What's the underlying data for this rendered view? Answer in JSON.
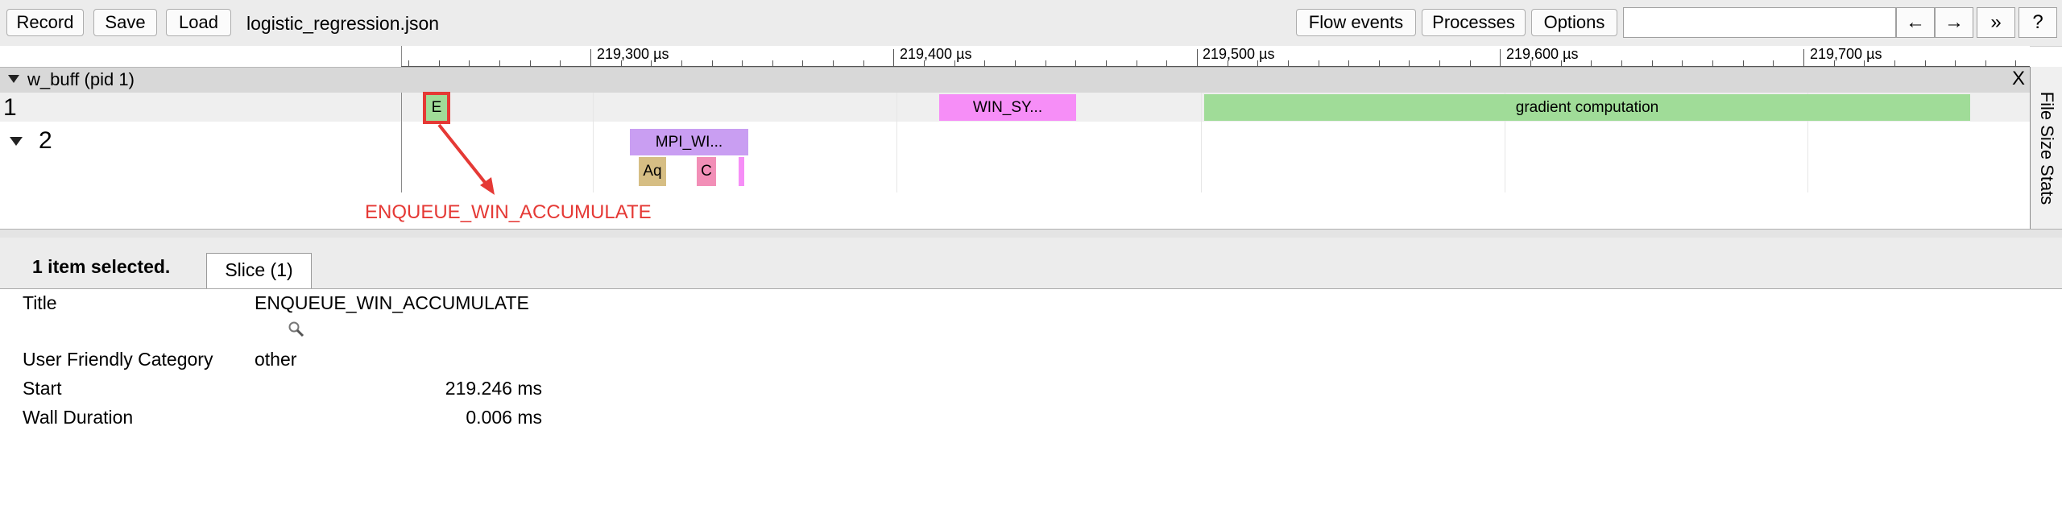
{
  "toolbar": {
    "record": "Record",
    "save": "Save",
    "load": "Load",
    "filename": "logistic_regression.json",
    "flow_events": "Flow events",
    "processes": "Processes",
    "options": "Options",
    "search_value": "",
    "prev": "←",
    "next": "→",
    "more": "»",
    "help": "?"
  },
  "ruler": {
    "labels": [
      "219,300 µs",
      "219,400 µs",
      "219,500 µs",
      "219,600 µs",
      "219,700 µs"
    ]
  },
  "process": {
    "title": "w_buff (pid 1)",
    "close": "X"
  },
  "threads": {
    "t1": "1",
    "t2": "2"
  },
  "slices": {
    "e": "E",
    "win_sy": "WIN_SY...",
    "gradient": "gradient computation",
    "mpi_wi": "MPI_WI...",
    "aq": "Aq",
    "c": "C"
  },
  "colors": {
    "green": "#a0dc98",
    "magenta": "#f68ef7",
    "purple": "#c99ef2",
    "tan": "#d6be84",
    "pink": "#f28fb7",
    "annotation": "#e53935"
  },
  "annotation": "ENQUEUE_WIN_ACCUMULATE",
  "side_tab": "File Size Stats",
  "panel": {
    "selection": "1 item selected.",
    "tab": "Slice (1)",
    "rows": {
      "title_key": "Title",
      "title_val": "ENQUEUE_WIN_ACCUMULATE",
      "cat_key": "User Friendly Category",
      "cat_val": "other",
      "start_key": "Start",
      "start_val": "219.246 ms",
      "dur_key": "Wall Duration",
      "dur_val": "0.006 ms"
    }
  }
}
